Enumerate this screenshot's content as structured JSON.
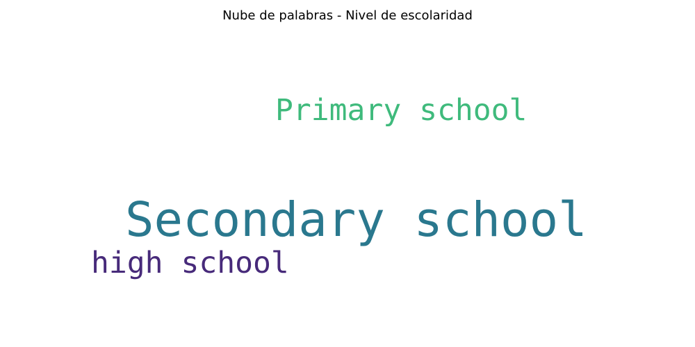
{
  "chart_data": {
    "type": "wordcloud",
    "title": "Nube de palabras - Nivel de escolaridad",
    "words": [
      {
        "text": "Secondary school",
        "color": "#2a788e"
      },
      {
        "text": "Primary school",
        "color": "#3fba7c"
      },
      {
        "text": "high school",
        "color": "#472a7a"
      }
    ]
  }
}
